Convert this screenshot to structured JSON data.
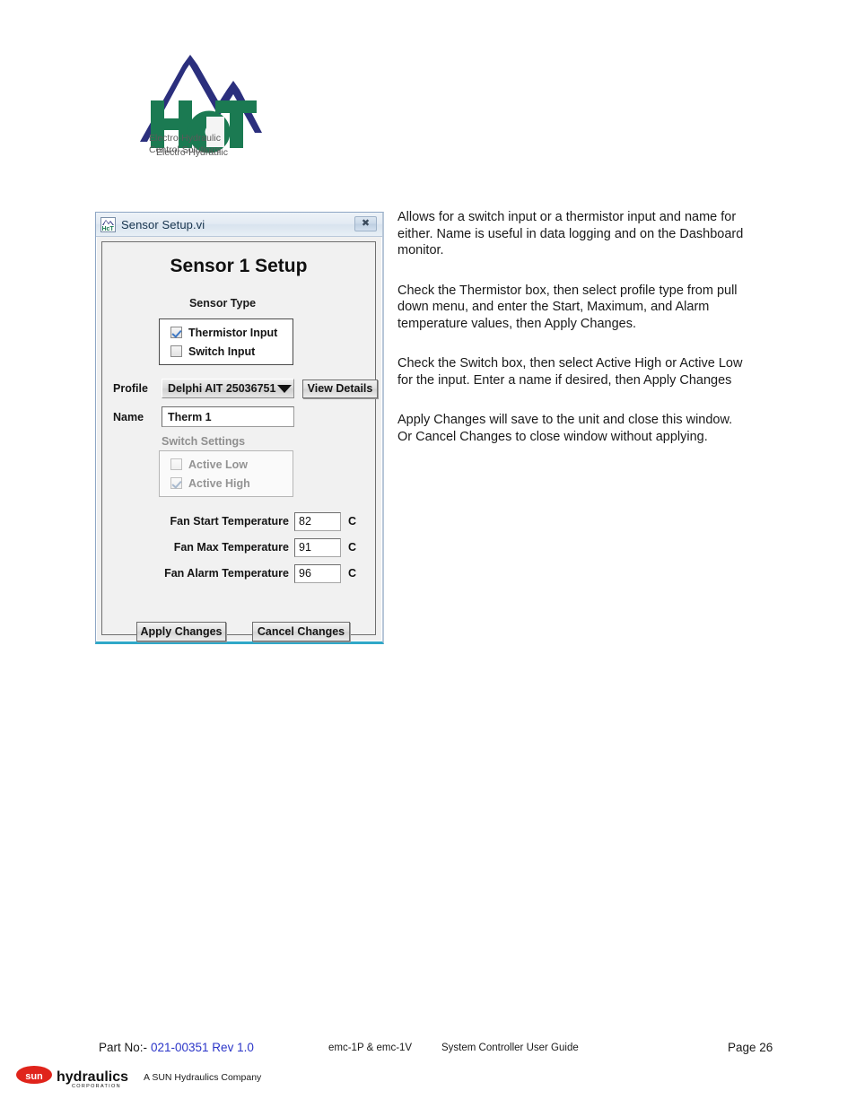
{
  "logo": {
    "brand": "HcT",
    "tagline_line1": "Electro-Hydraulic",
    "tagline_line2": "Control Solutions",
    "mountain_color": "#2b2f7d",
    "text_color": "#1b7a52"
  },
  "dialog": {
    "titlebar": {
      "icon": "hct-app-icon",
      "title": "Sensor Setup.vi",
      "close_glyph": "✖"
    },
    "heading": "Sensor 1 Setup",
    "sensor_type": {
      "label": "Sensor Type",
      "options": [
        {
          "label": "Thermistor Input",
          "checked": true
        },
        {
          "label": "Switch Input",
          "checked": false
        }
      ]
    },
    "profile": {
      "label": "Profile",
      "value": "Delphi AIT 25036751",
      "view_details_label": "View Details"
    },
    "name": {
      "label": "Name",
      "value": "Therm 1"
    },
    "switch_settings": {
      "label": "Switch Settings",
      "enabled": false,
      "options": [
        {
          "label": "Active Low",
          "checked": false
        },
        {
          "label": "Active High",
          "checked": true
        }
      ]
    },
    "temperatures": [
      {
        "label": "Fan Start Temperature",
        "value": "82",
        "unit": "C"
      },
      {
        "label": "Fan Max Temperature",
        "value": "91",
        "unit": "C"
      },
      {
        "label": "Fan Alarm Temperature",
        "value": "96",
        "unit": "C"
      }
    ],
    "buttons": {
      "apply": "Apply Changes",
      "cancel": "Cancel Changes"
    }
  },
  "description": {
    "paragraph1": "Allows for a switch input or a thermistor input and name for either. Name is useful in data logging and on the Dashboard monitor.",
    "paragraph2": "Check the Thermistor box, then select profile type from pull down menu, and enter the Start, Maximum, and Alarm temperature values, then Apply Changes.",
    "paragraph3": "Check the Switch box, then select Active High or Active Low for the input. Enter a name if desired, then Apply Changes",
    "paragraph4": "Apply Changes will save to the unit and close this window. Or Cancel Changes to close window without applying."
  },
  "footer": {
    "part_label": "Part No:-",
    "part_number": "021-00351 Rev 1.0",
    "part_number_color": "#2b35c8",
    "product": "emc-1P & emc-1V",
    "document": "System Controller User Guide",
    "page": "Page 26",
    "sun_logo_mark": "sun",
    "sun_logo_word": "hydraulics",
    "sun_logo_sub": "CORPORATION",
    "sun_tagline": "A SUN Hydraulics Company",
    "sun_red": "#e0241b"
  }
}
